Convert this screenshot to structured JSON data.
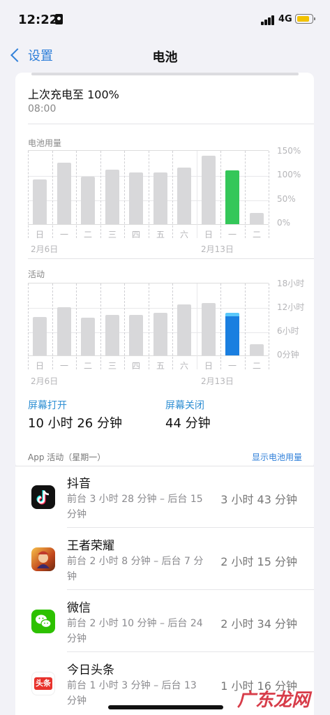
{
  "status_bar": {
    "time": "12:22",
    "network": "4G"
  },
  "nav": {
    "back_label": "设置",
    "title": "电池"
  },
  "last_charge": {
    "title": "上次充电至 100%",
    "time": "08:00"
  },
  "battery_usage": {
    "label": "电池用量",
    "y_ticks": [
      "150%",
      "100%",
      "50%",
      "0%"
    ]
  },
  "activity": {
    "label": "活动",
    "y_ticks": [
      "18小时",
      "12小时",
      "6小时",
      "0分钟"
    ]
  },
  "days": [
    "日",
    "一",
    "二",
    "三",
    "四",
    "五",
    "六",
    "日",
    "一",
    "二"
  ],
  "dates": [
    "2月6日",
    "2月13日"
  ],
  "chart_data": [
    {
      "type": "bar",
      "title": "电池用量",
      "categories": [
        "日",
        "一",
        "二",
        "三",
        "四",
        "五",
        "六",
        "日",
        "一",
        "二"
      ],
      "values": [
        90,
        123,
        95,
        110,
        104,
        104,
        114,
        138,
        108,
        22
      ],
      "highlight_index": 8,
      "highlight_color": "#34c759",
      "ylim": [
        0,
        150
      ],
      "y_unit": "%",
      "week_labels": [
        "2月6日",
        "2月13日"
      ]
    },
    {
      "type": "bar",
      "title": "活动",
      "categories": [
        "日",
        "一",
        "二",
        "三",
        "四",
        "五",
        "六",
        "日",
        "一",
        "二"
      ],
      "values": [
        9.5,
        11.8,
        9.2,
        10.0,
        10.0,
        10.5,
        12.5,
        12.8,
        10.4,
        2.8
      ],
      "highlight_index": 8,
      "highlight_color": "#1a7fe0",
      "highlight_secondary_color": "#5ac8fa",
      "ylim": [
        0,
        18
      ],
      "y_unit": "小时",
      "week_labels": [
        "2月6日",
        "2月13日"
      ]
    }
  ],
  "screen": {
    "on_label": "屏幕打开",
    "on_value": "10 小时 26 分钟",
    "off_label": "屏幕关闭",
    "off_value": "44 分钟"
  },
  "app_activity": {
    "header": "App 活动（星期一）",
    "link": "显示电池用量",
    "apps": [
      {
        "name": "抖音",
        "detail": "前台 3 小时 28 分钟 – 后台 15 分钟",
        "total": "3 小时 43 分钟",
        "icon": "douyin-icon"
      },
      {
        "name": "王者荣耀",
        "detail": "前台 2 小时 8 分钟 – 后台 7 分钟",
        "total": "2 小时 15 分钟",
        "icon": "honor-of-kings-icon"
      },
      {
        "name": "微信",
        "detail": "前台 2 小时 10 分钟 – 后台 24 分钟",
        "total": "2 小时 34 分钟",
        "icon": "wechat-icon"
      },
      {
        "name": "今日头条",
        "detail": "前台 1 小时 3 分钟 – 后台 13 分钟",
        "total": "1 小时 16 分钟",
        "icon": "toutiao-icon",
        "icon_text": "头条"
      }
    ]
  },
  "watermark": "广东龙网",
  "colors": {
    "accent": "#2f7fd9",
    "battery_green": "#34c759",
    "activity_blue": "#1a7fe0",
    "battery_yellow": "#f2c200"
  }
}
